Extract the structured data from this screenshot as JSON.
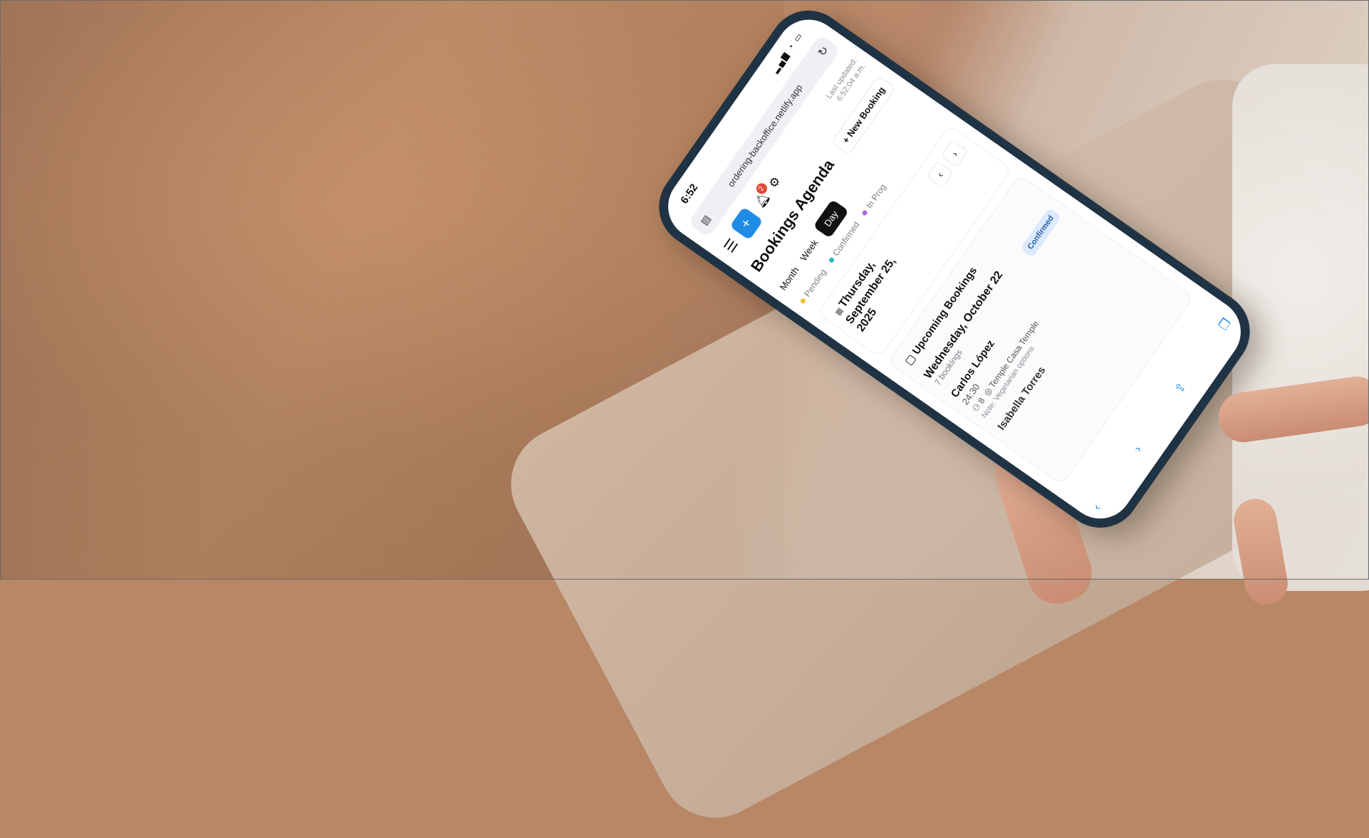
{
  "colors": {
    "accent": "#1e8ce6",
    "badge": "#e2463a",
    "pending": "#f2c230",
    "confirmed": "#2bb3c0",
    "in_progress": "#a56be0"
  },
  "status_bar": {
    "time": "6:52",
    "icons": "signal-icon wifi-icon battery-icon"
  },
  "browser": {
    "url": "ordering-backoffice.netlify.app"
  },
  "toolbar": {
    "notification_count": "2",
    "last_updated_label": "Last updated:",
    "last_updated_time": "6:52:04 a.m."
  },
  "header": {
    "title": "Bookings Agenda",
    "new_booking": "New Booking"
  },
  "views": {
    "month": "Month",
    "week": "Week",
    "day": "Day"
  },
  "legend": {
    "pending": "Pending",
    "confirmed": "Confirmed",
    "in_progress": "In Prog"
  },
  "date_card": {
    "date": "Thursday, September 25, 2025"
  },
  "upcoming": {
    "title": "Upcoming Bookings",
    "day": "Wednesday, October 22",
    "count": "7 bookings",
    "status": "Confirmed",
    "booking": {
      "name": "Carlos López",
      "time": "24:30",
      "guests": "8",
      "location": "Temple Casa Temple",
      "note": "Note: Vegetarian options"
    },
    "next_name": "Isabella Torres"
  }
}
